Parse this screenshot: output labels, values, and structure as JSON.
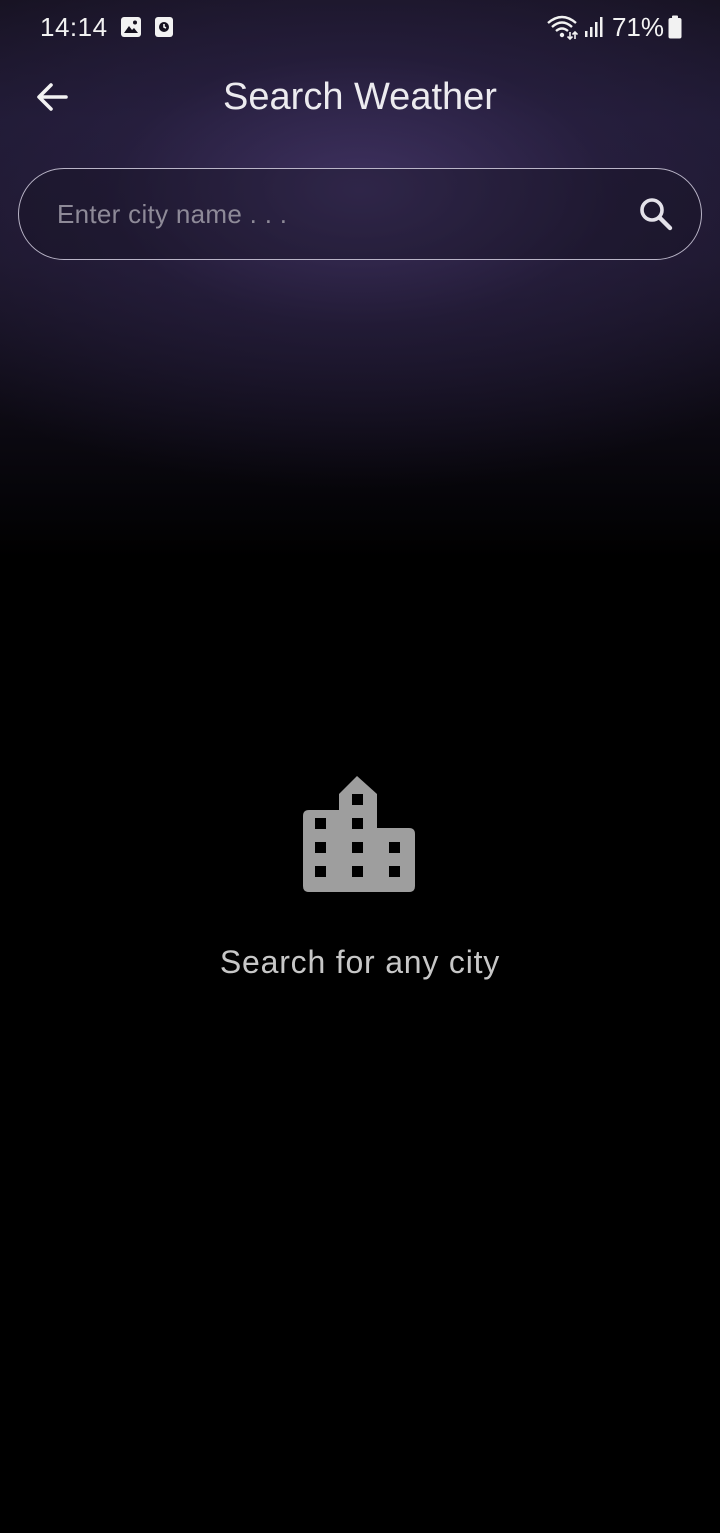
{
  "status_bar": {
    "time": "14:14",
    "battery_percent": "71%",
    "icons": [
      "gallery-icon",
      "clock-notification-icon",
      "wifi-icon",
      "signal-icon",
      "battery-icon"
    ]
  },
  "header": {
    "back_icon": "arrow-left-icon",
    "title": "Search Weather"
  },
  "search": {
    "value": "",
    "placeholder": "Enter city name . . .",
    "icon": "search-icon"
  },
  "empty_state": {
    "icon": "city-buildings-icon",
    "message": "Search for any city"
  },
  "colors": {
    "background": "#000000",
    "glow": "#3a2d57",
    "search_border": "#b9b4c7",
    "placeholder": "#8e8a98",
    "empty_icon": "#9e9e9e",
    "empty_text": "#c7c7c7"
  }
}
